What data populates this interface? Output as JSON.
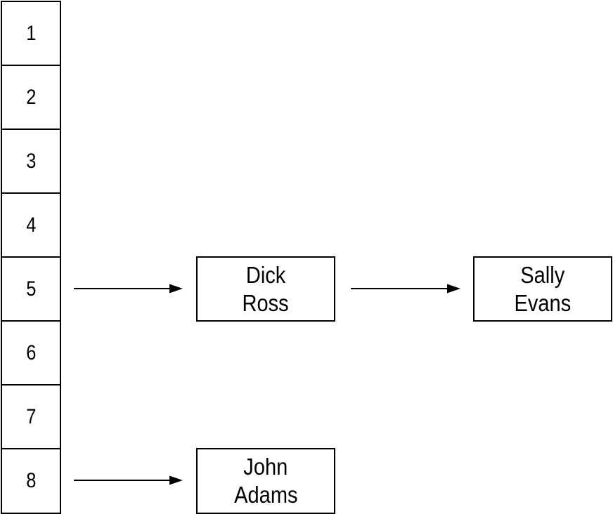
{
  "table": {
    "slots": [
      "1",
      "2",
      "3",
      "4",
      "5",
      "6",
      "7",
      "8"
    ]
  },
  "nodes": [
    {
      "line1": "Dick",
      "line2": "Ross"
    },
    {
      "line1": "Sally",
      "line2": "Evans"
    },
    {
      "line1": "John",
      "line2": "Adams"
    }
  ],
  "links": [
    {
      "from": "slot 5",
      "to": "Dick Ross"
    },
    {
      "from": "Dick Ross",
      "to": "Sally Evans"
    },
    {
      "from": "slot 8",
      "to": "John Adams"
    }
  ]
}
